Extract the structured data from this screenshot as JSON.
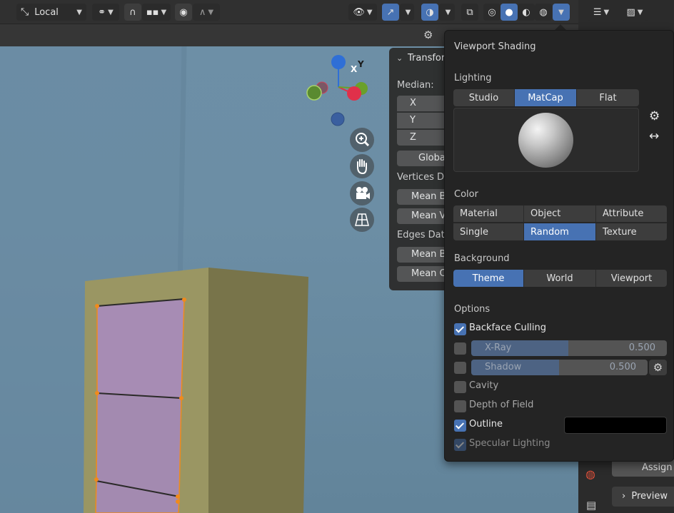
{
  "header": {
    "transform_orientation": "Local",
    "icons": [
      "pivot-icon",
      "snap-icon",
      "snap-target-icon",
      "proportional-edit-icon",
      "falloff-icon",
      "visibility-icon",
      "gizmo-icon",
      "overlay-icon",
      "xray-icon",
      "wireframe-shading-icon",
      "solid-shading-icon",
      "material-preview-icon",
      "rendered-shading-icon",
      "shading-dropdown-icon"
    ]
  },
  "n_panel": {
    "title": "Transfor",
    "median_label": "Median:",
    "axes": [
      "X",
      "Y",
      "Z"
    ],
    "global_button": "Globa",
    "vertices_label": "Vertices D",
    "vertex_fields": [
      "Mean B",
      "Mean V"
    ],
    "edges_label": "Edges Dat",
    "edge_fields": [
      "Mean B",
      "Mean C"
    ]
  },
  "gizmo": {
    "z": "Z",
    "y": "Y",
    "x": "X"
  },
  "popover": {
    "title": "Viewport Shading",
    "lighting": {
      "label": "Lighting",
      "options": [
        "Studio",
        "MatCap",
        "Flat"
      ],
      "selected": "MatCap"
    },
    "color": {
      "label": "Color",
      "options": [
        "Material",
        "Object",
        "Attribute",
        "Single",
        "Random",
        "Texture"
      ],
      "selected": "Random"
    },
    "background": {
      "label": "Background",
      "options": [
        "Theme",
        "World",
        "Viewport"
      ],
      "selected": "Theme"
    },
    "options": {
      "label": "Options",
      "backface_culling": {
        "label": "Backface Culling",
        "checked": true
      },
      "xray": {
        "label": "X-Ray",
        "value": "0.500",
        "checked": false
      },
      "shadow": {
        "label": "Shadow",
        "value": "0.500",
        "checked": false
      },
      "cavity": {
        "label": "Cavity",
        "checked": false
      },
      "depth_of_field": {
        "label": "Depth of Field",
        "checked": false
      },
      "outline": {
        "label": "Outline",
        "checked": true,
        "color": "#000000"
      },
      "specular_lighting": {
        "label": "Specular Lighting",
        "checked": true
      }
    }
  },
  "properties": {
    "assign": "Assign",
    "preview": "Preview"
  },
  "colors": {
    "accent": "#4772b3",
    "selection": "#f08a1c",
    "face": "#a48bb0",
    "cabinet": "#96925f"
  }
}
